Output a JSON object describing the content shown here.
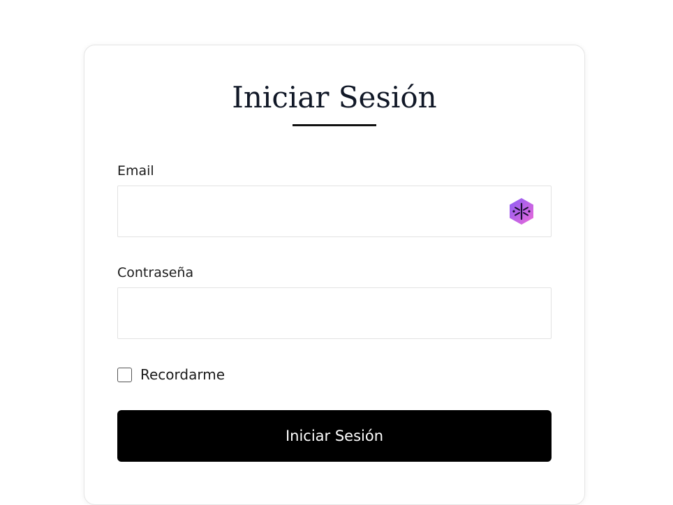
{
  "login": {
    "title": "Iniciar Sesión",
    "email_label": "Email",
    "email_value": "",
    "password_label": "Contraseña",
    "password_value": "",
    "remember_label": "Recordarme",
    "remember_checked": false,
    "submit_label": "Iniciar Sesión"
  },
  "icons": {
    "email_field_extension": "password-manager-icon"
  },
  "colors": {
    "button_bg": "#000000",
    "button_text": "#ffffff",
    "title_text": "#111827",
    "icon_gradient_start": "#8b5cf6",
    "icon_gradient_end": "#ec6ad8"
  }
}
